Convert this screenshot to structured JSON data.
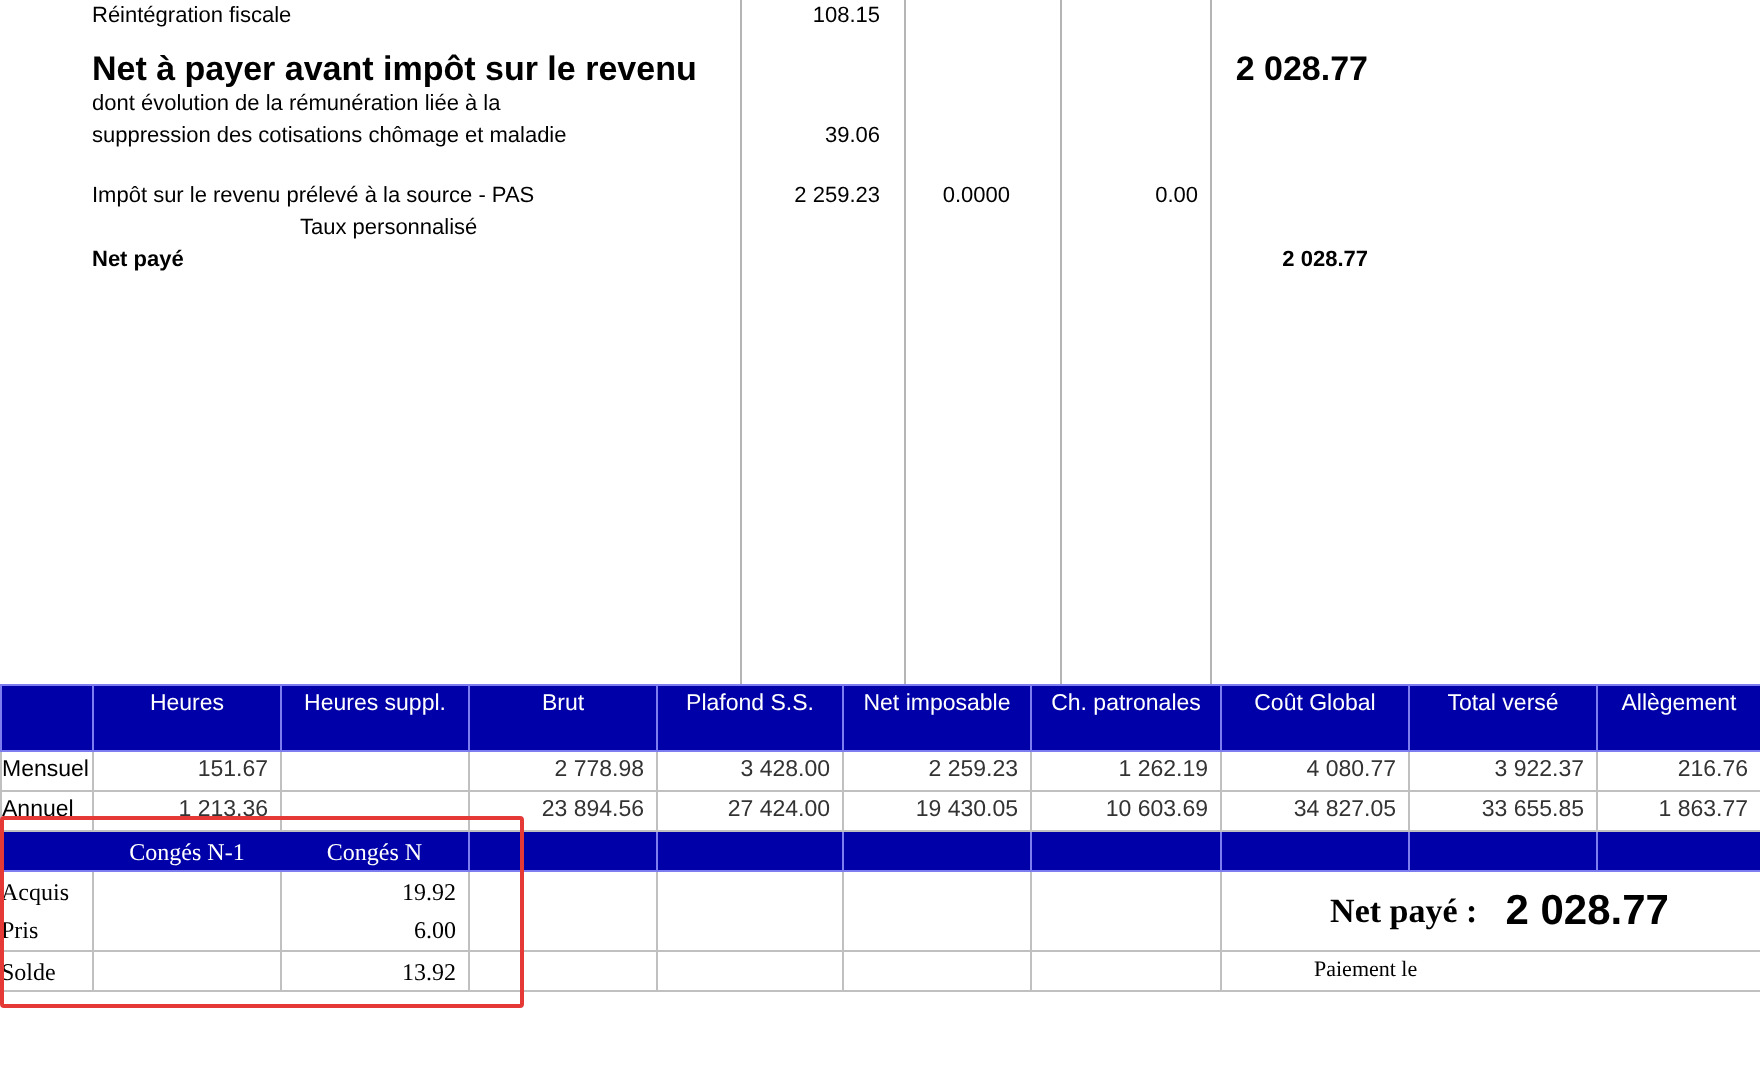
{
  "statement": {
    "lines": [
      {
        "kind": "normal",
        "label": "Réintégration fiscale",
        "column_1": "108.15"
      },
      {
        "kind": "heading",
        "label": "Net à payer avant impôt sur le revenu",
        "column_4": "2 028.77"
      },
      {
        "kind": "normal",
        "label": "dont évolution de la rémunération liée à la"
      },
      {
        "kind": "normal",
        "label": "suppression des cotisations chômage et maladie",
        "column_1": "39.06"
      },
      {
        "kind": "spaced",
        "label": "Impôt sur le revenu prélevé à la source - PAS",
        "column_1": "2 259.23",
        "column_2": "0.0000",
        "column_3": "0.00"
      },
      {
        "kind": "indented",
        "label": "Taux personnalisé"
      },
      {
        "kind": "total",
        "label": "Net payé",
        "column_4": "2 028.77"
      }
    ]
  },
  "summary": {
    "columns": [
      "Heures",
      "Heures suppl.",
      "Brut",
      "Plafond S.S.",
      "Net imposable",
      "Ch. patronales",
      "Coût Global",
      "Total versé",
      "Allègement"
    ],
    "rows": [
      {
        "label": "Mensuel",
        "heures": "151.67",
        "brut": "2 778.98",
        "plafond_ss": "3 428.00",
        "net_imposable": "2 259.23",
        "ch_patronales": "1 262.19",
        "cout_global": "4 080.77",
        "total_verse": "3 922.37",
        "allegement": "216.76"
      },
      {
        "label": "Annuel",
        "heures": "1 213.36",
        "brut": "23 894.56",
        "plafond_ss": "27 424.00",
        "net_imposable": "19 430.05",
        "ch_patronales": "10 603.69",
        "cout_global": "34 827.05",
        "total_verse": "33 655.85",
        "allegement": "1 863.77"
      }
    ]
  },
  "leave": {
    "columns": [
      "Congés N-1",
      "Congés N"
    ],
    "rows": [
      {
        "label": "Acquis",
        "conges_n": "19.92"
      },
      {
        "label": "Pris",
        "conges_n": "6.00"
      },
      {
        "label": "Solde",
        "conges_n": "13.92"
      }
    ],
    "highlighted": true
  },
  "net": {
    "label": "Net payé :",
    "amount": "2 028.77",
    "payment_label": "Paiement le"
  }
}
